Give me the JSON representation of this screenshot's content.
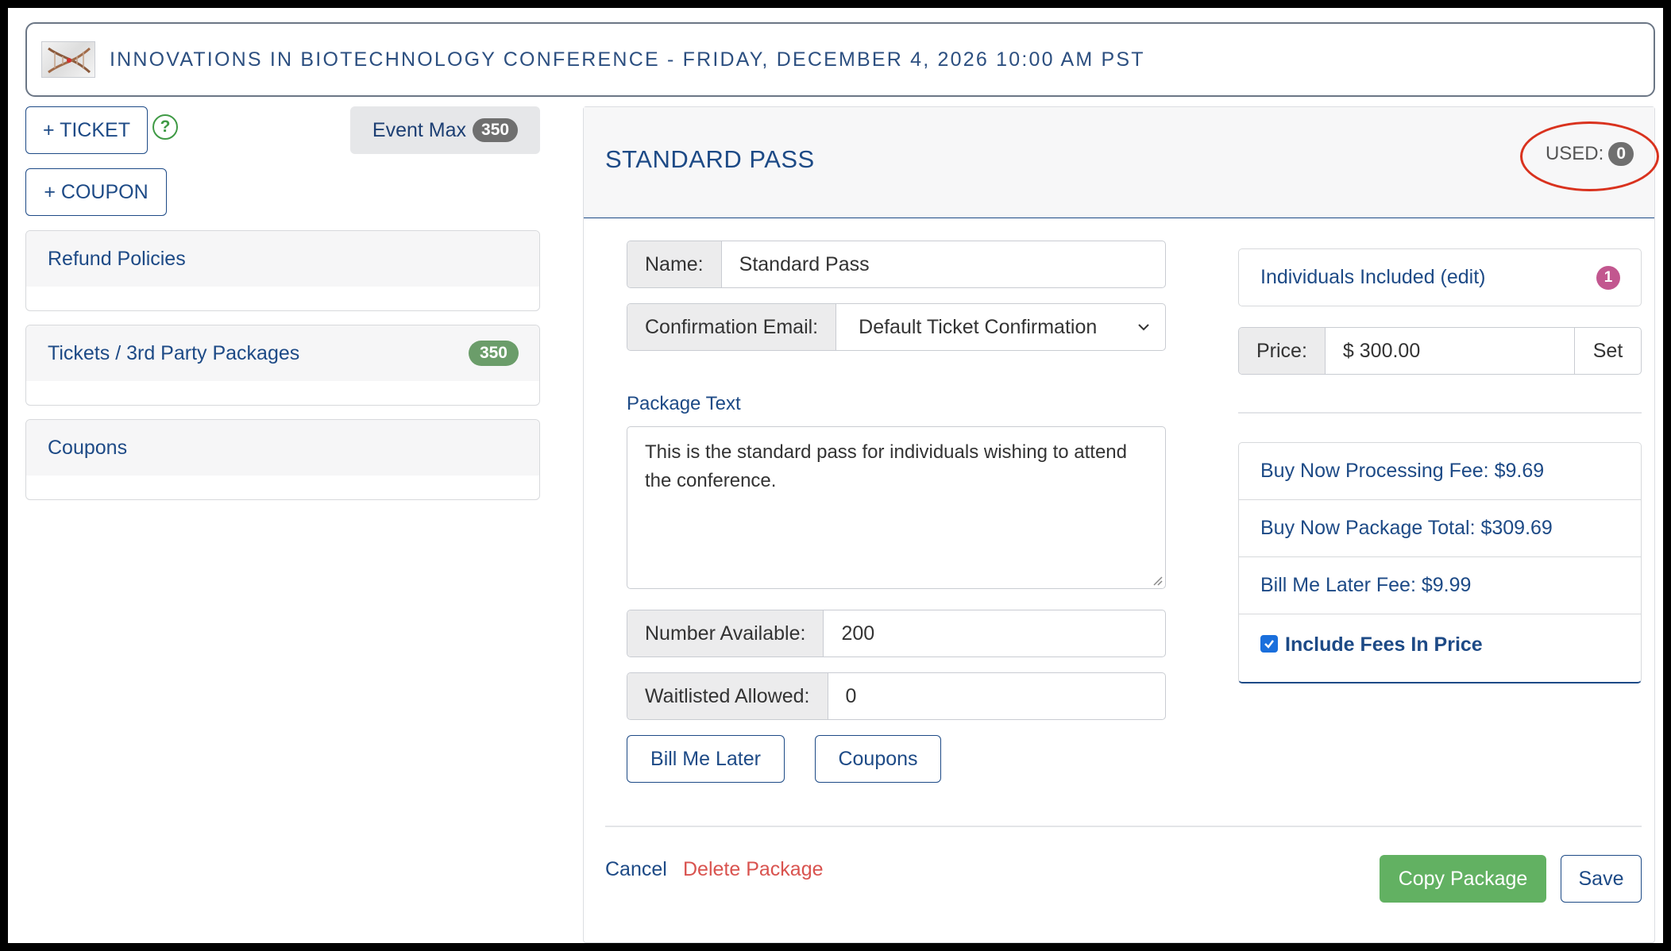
{
  "header": {
    "title": "INNOVATIONS IN BIOTECHNOLOGY CONFERENCE - FRIDAY, DECEMBER 4, 2026 10:00 AM PST",
    "logo_icon": "dna-image"
  },
  "sidebar": {
    "add_ticket_label": "+ TICKET",
    "add_coupon_label": "+ COUPON",
    "help_icon": "?",
    "event_max_label": "Event Max",
    "event_max_count": "350",
    "cards": [
      {
        "label": "Refund Policies",
        "badge": ""
      },
      {
        "label": "Tickets / 3rd Party Packages",
        "badge": "350"
      },
      {
        "label": "Coupons",
        "badge": ""
      }
    ]
  },
  "package": {
    "title": "STANDARD PASS",
    "used_label": "USED:",
    "used_count": "0",
    "name_label": "Name:",
    "name_value": "Standard Pass",
    "confirmation_label": "Confirmation Email:",
    "confirmation_value": "Default Ticket Confirmation",
    "package_text_label": "Package Text",
    "package_text_value": "This is the standard pass for individuals wishing to attend the conference.",
    "number_available_label": "Number Available:",
    "number_available_value": "200",
    "waitlisted_label": "Waitlisted Allowed:",
    "waitlisted_value": "0",
    "bill_me_later_label": "Bill Me Later",
    "coupons_label": "Coupons",
    "individuals_label": "Individuals Included (edit)",
    "individuals_count": "1",
    "price_label": "Price:",
    "price_value": "$ 300.00",
    "set_label": "Set",
    "fees": {
      "processing_fee": "Buy Now Processing Fee: $9.69",
      "package_total": "Buy Now Package Total: $309.69",
      "bill_later_fee": "Bill Me Later Fee: $9.99",
      "include_fees_label": "Include Fees In Price",
      "include_fees_checked": true
    },
    "cancel_label": "Cancel",
    "delete_label": "Delete Package",
    "copy_label": "Copy Package",
    "save_label": "Save"
  },
  "colors": {
    "primary": "#1d4a86",
    "danger": "#d9534f",
    "success": "#62b162",
    "highlight": "#d9321e"
  }
}
